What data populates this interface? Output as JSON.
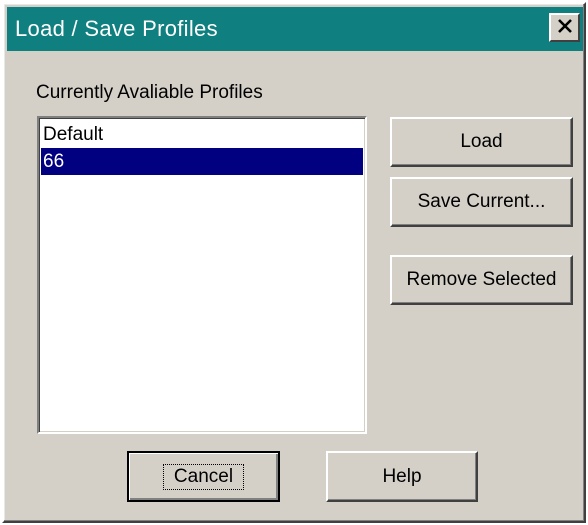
{
  "window": {
    "title": "Load / Save Profiles",
    "close_icon": "close-icon"
  },
  "profiles": {
    "label": "Currently Avaliable Profiles",
    "items": [
      {
        "name": "Default",
        "selected": false
      },
      {
        "name": "66",
        "selected": true
      }
    ]
  },
  "buttons": {
    "load": "Load",
    "save_current": "Save Current...",
    "remove_selected": "Remove Selected",
    "cancel": "Cancel",
    "help": "Help"
  },
  "colors": {
    "titlebar": "#0f7f7f",
    "face": "#d4d0c8",
    "selection": "#000080"
  }
}
